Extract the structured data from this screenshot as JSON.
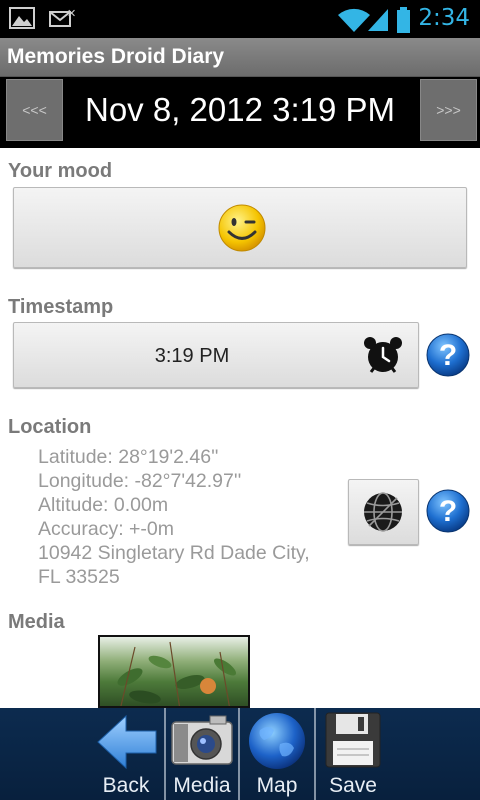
{
  "status_bar": {
    "time": "2:34",
    "icons": [
      "picture-icon",
      "missed-call-icon",
      "wifi-icon",
      "signal-icon",
      "battery-icon"
    ]
  },
  "app": {
    "title": "Memories Droid Diary"
  },
  "date_header": {
    "prev_label": "<<<",
    "date": "Nov 8, 2012 3:19 PM",
    "next_label": ">>>"
  },
  "mood": {
    "label": "Your mood",
    "icon": "wink-smiley-icon"
  },
  "timestamp": {
    "label": "Timestamp",
    "value": "3:19 PM",
    "icon": "alarm-clock-icon"
  },
  "location": {
    "label": "Location",
    "lines": [
      "Latitude: 28°19'2.46''",
      "Longitude: -82°7'42.97''",
      "Altitude: 0.00m",
      "Accuracy: +-0m",
      "10942 Singletary Rd Dade City,",
      "FL 33525"
    ],
    "icon": "globe-icon"
  },
  "media": {
    "label": "Media"
  },
  "bottom_bar": {
    "items": [
      {
        "label": "Back",
        "icon": "back-arrow-icon"
      },
      {
        "label": "Media",
        "icon": "camera-icon"
      },
      {
        "label": "Map",
        "icon": "earth-icon"
      },
      {
        "label": "Save",
        "icon": "floppy-disk-icon"
      }
    ]
  },
  "colors": {
    "status_time": "#33b5e5",
    "help_blue": "#1e6fd0",
    "bottom_bar": "#0c2b4f"
  }
}
